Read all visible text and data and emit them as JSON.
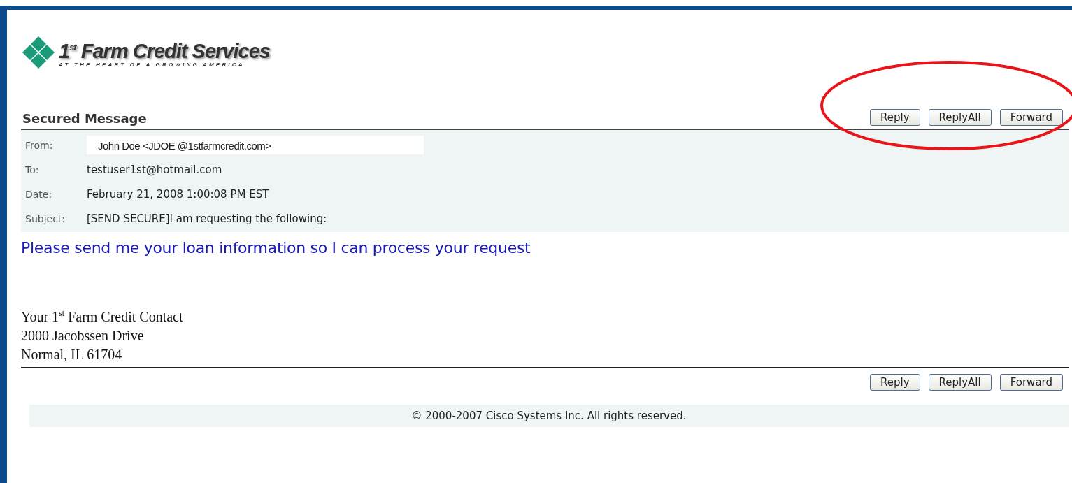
{
  "logo": {
    "name": "1$^{st}$ Farm Credit Services",
    "tagline": "AT THE HEART OF A GROWING AMERICA"
  },
  "title": "Secured Message",
  "top_buttons": [
    "Reply",
    "ReplyAll",
    "Forward"
  ],
  "headers": [
    {
      "label": "From:",
      "value": "John Doe <JDOE @1stfarmcredit.com>",
      "kind": "highlighted"
    },
    {
      "label": "To:",
      "value": "testuser1st@hotmail.com",
      "kind": "plain"
    },
    {
      "label": "Date:",
      "value": "February 21, 2008 1:00:08 PM EST",
      "kind": "plain"
    },
    {
      "label": "Subject:",
      "value": "[SEND SECURE]I am requesting the following:",
      "kind": "plain"
    }
  ],
  "body": "Please send me your loan information so I can process your request",
  "signature": [
    "Your 1$^{st}$ Farm Credit Contact",
    "2000 Jacobssen Drive",
    "Normal, IL 61704"
  ],
  "bottom_buttons": [
    "Reply",
    "ReplyAll",
    "Forward"
  ],
  "footer": "© 2000-2007 Cisco Systems Inc. All rights reserved."
}
